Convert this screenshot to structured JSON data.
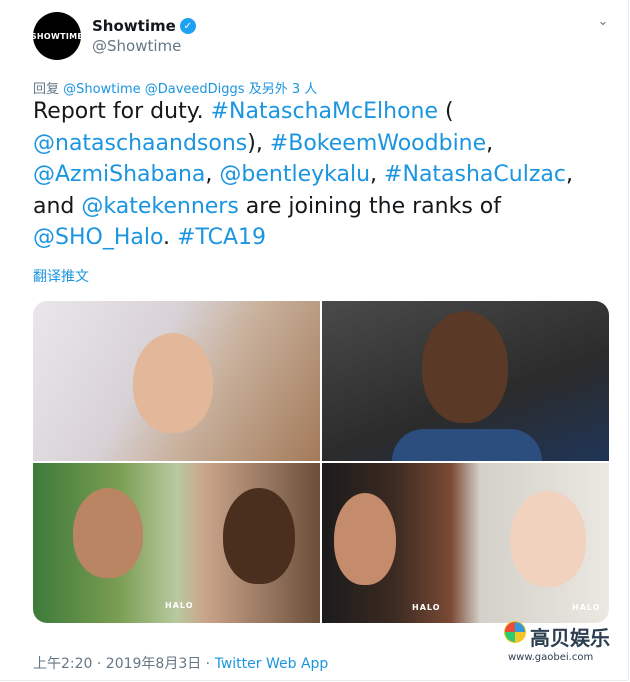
{
  "tweet": {
    "display_name": "Showtime",
    "handle": "@Showtime",
    "avatar_text": "SHOWTIME",
    "reply_prefix": "回复",
    "reply_users": "@Showtime @DaveedDiggs",
    "reply_suffix": "及另外 3 人",
    "text": {
      "t1": "Report for duty. ",
      "h1": "#NataschaMcElhone",
      "t2": " (",
      "m1": "@nataschaandsons",
      "t3": "), ",
      "h2": "#BokeemWoodbine",
      "t4": ", ",
      "m2": "@AzmiShabana",
      "t5": ", ",
      "m3": "@bentleykalu",
      "t6": ", ",
      "h3": "#NatashaCulzac",
      "t7": ", and ",
      "m4": "@katekenners",
      "t8": " are joining the ranks of ",
      "m5": "@SHO_Halo",
      "t9": ". ",
      "h4": "#TCA19"
    },
    "translate_label": "翻译推文",
    "timestamp": "上午2:20 · 2019年8月3日 · ",
    "source": "Twitter Web App",
    "photo_logos": [
      "HALO",
      "HALO",
      "HALO"
    ]
  },
  "watermark": {
    "name": "高贝娱乐",
    "url": "www.gaobei.com"
  },
  "colors": {
    "link": "#1b95e0",
    "muted": "#657786",
    "verified": "#1da1f2"
  },
  "icons": [
    "verified-badge-icon",
    "chevron-down-icon"
  ]
}
